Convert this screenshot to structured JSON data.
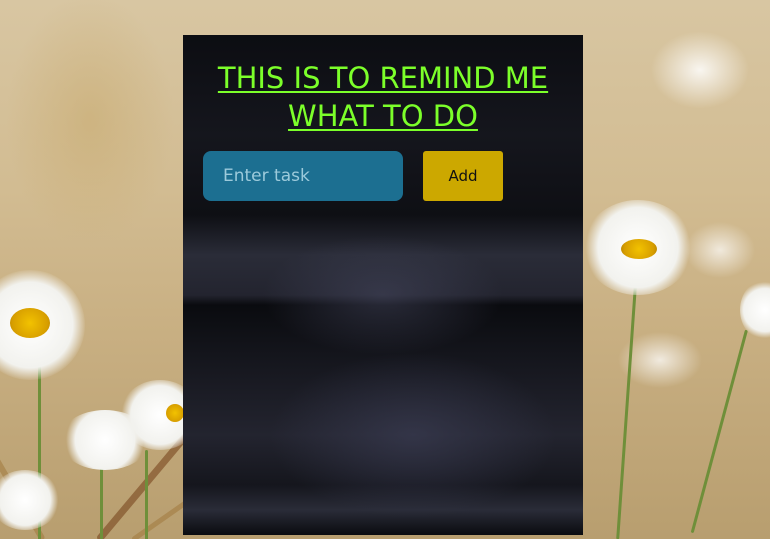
{
  "app": {
    "title": "THIS IS TO REMIND ME WHAT TO DO"
  },
  "task_form": {
    "input_value": "",
    "input_placeholder": "Enter task",
    "add_label": "Add"
  },
  "tasks": [],
  "colors": {
    "title": "#7cff2a",
    "input_background": "#1c6f91",
    "add_button": "#cca800",
    "card_background": "#0e0f14"
  },
  "background": {
    "description_icon": "daisy-field-photo"
  }
}
